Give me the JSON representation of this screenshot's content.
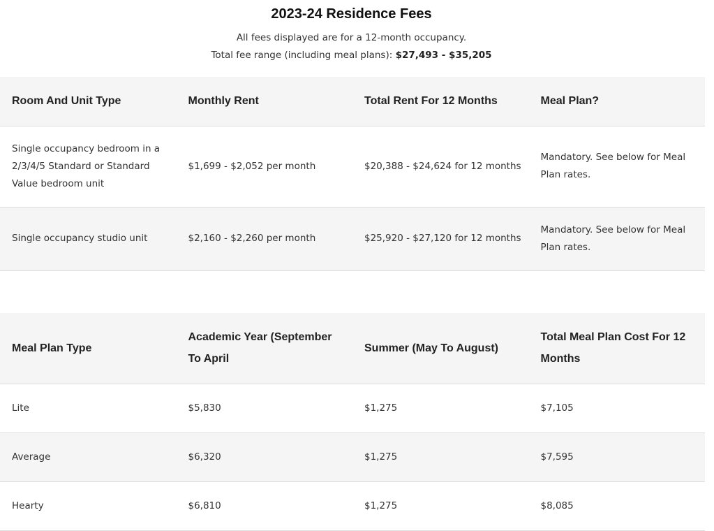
{
  "header": {
    "title": "2023-24 Residence Fees",
    "line1": "All fees displayed are for a 12-month occupancy.",
    "line2_prefix": "Total fee range (including meal plans): ",
    "line2_range": "$27,493 - $35,205"
  },
  "rent_table": {
    "columns": [
      "Room And Unit Type",
      "Monthly Rent",
      "Total Rent For 12 Months",
      "Meal Plan?"
    ],
    "rows": [
      [
        "Single occupancy bedroom in a 2/3/4/5 Standard or Standard Value bedroom unit",
        "$1,699 - $2,052 per month",
        "$20,388 - $24,624 for 12 months",
        "Mandatory. See below for Meal Plan rates."
      ],
      [
        "Single occupancy studio unit",
        "$2,160 - $2,260 per month",
        "$25,920 - $27,120 for 12 months",
        "Mandatory. See below for Meal Plan rates."
      ]
    ]
  },
  "meal_table": {
    "columns": [
      "Meal Plan Type",
      "Academic Year (September To April",
      "Summer (May To August)",
      "Total Meal Plan Cost For 12 Months"
    ],
    "rows": [
      [
        "Lite",
        "$5,830",
        "$1,275",
        "$7,105"
      ],
      [
        "Average",
        "$6,320",
        "$1,275",
        "$7,595"
      ],
      [
        "Hearty",
        "$6,810",
        "$1,275",
        "$8,085"
      ]
    ]
  }
}
